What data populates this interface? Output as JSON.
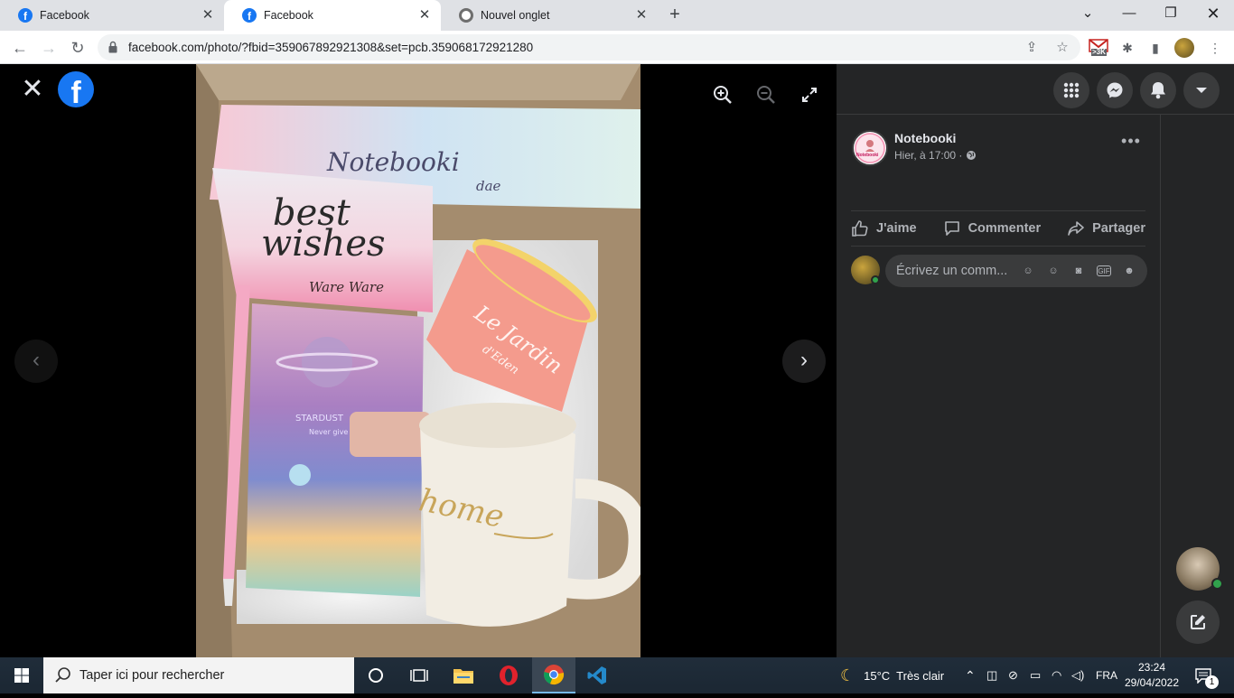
{
  "tabs": [
    {
      "title": "Facebook",
      "favicon": "facebook-icon"
    },
    {
      "title": "Facebook",
      "favicon": "facebook-icon",
      "active": true
    },
    {
      "title": "Nouvel onglet",
      "favicon": "chrome-icon"
    }
  ],
  "toolbar": {
    "url": "facebook.com/photo/?fbid=359067892921308&set=pcb.359068172921280",
    "gmail_badge": ">3K"
  },
  "viewer": {
    "close_icon": "close-icon",
    "photo_alt": "Coffret cadeau Notebooki",
    "photo_text": {
      "box_brand": "Notebooki",
      "box_sub": "dae",
      "card_line1": "best",
      "card_line2": "wishes",
      "card_logo": "Ware Ware",
      "notebook_title": "STARDUST",
      "notebook_sub": "Never give",
      "cup_text": "Le Jardin",
      "cup_sub": "d'Eden",
      "mug_text": "home"
    }
  },
  "panel": {
    "page_name": "Notebooki",
    "page_avatar_text": "Notebooki",
    "post_time": "Hier, à 17:00 ·",
    "actions": {
      "like": "J'aime",
      "comment": "Commenter",
      "share": "Partager"
    },
    "comment_placeholder": "Écrivez un comm..."
  },
  "taskbar": {
    "search_placeholder": "Taper ici pour rechercher",
    "weather": "15°C  Très clair",
    "language": "FRA",
    "time": "23:24",
    "date": "29/04/2022",
    "notifications": "1"
  },
  "colors": {
    "facebook_blue": "#1877f2",
    "panel_bg": "#242526",
    "online_green": "#31a24c"
  }
}
